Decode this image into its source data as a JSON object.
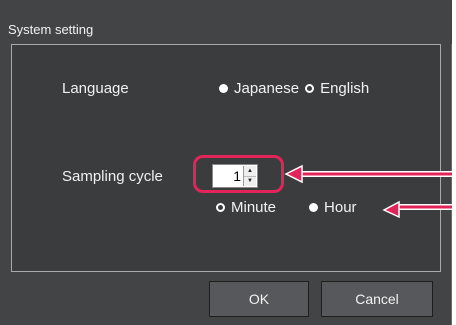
{
  "window": {
    "title": "System setting"
  },
  "language": {
    "label": "Language",
    "options": [
      {
        "label": "Japanese",
        "selected": false
      },
      {
        "label": "English",
        "selected": true
      }
    ]
  },
  "sampling": {
    "label": "Sampling cycle",
    "value": "1",
    "units": [
      {
        "label": "Minute",
        "selected": true
      },
      {
        "label": "Hour",
        "selected": false
      }
    ]
  },
  "buttons": {
    "ok": "OK",
    "cancel": "Cancel"
  },
  "colors": {
    "highlight": "#e3245a",
    "window_bg": "#434446",
    "panel_border": "#a9a9a9"
  },
  "icons": {
    "spin_up": "spin-up-arrow-icon",
    "spin_down": "spin-down-arrow-icon"
  }
}
